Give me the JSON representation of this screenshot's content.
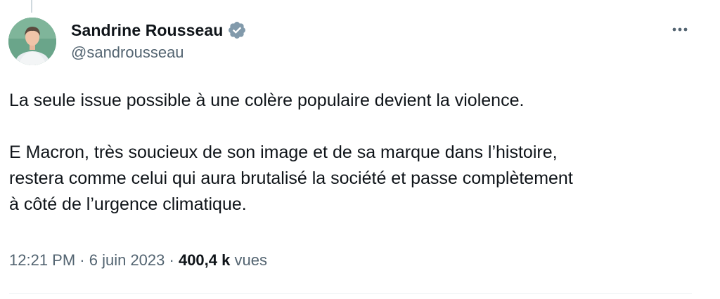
{
  "author": {
    "display_name": "Sandrine Rousseau",
    "handle": "@sandrousseau"
  },
  "tweet": {
    "text": "La seule issue possible à une colère populaire devient la violence.\n\nE Macron, très soucieux de son image et de sa marque dans l’histoire,\nrestera comme celui qui aura brutalisé la société et passe complètement\nà côté de l’urgence climatique."
  },
  "meta": {
    "time": "12:21 PM",
    "separator": " · ",
    "date": "6 juin 2023",
    "views_count": "400,4 k",
    "views_label": "vues"
  },
  "icons": {
    "verified": "verified-badge-icon",
    "more": "more-options-icon"
  },
  "colors": {
    "text_primary": "#0f1419",
    "text_secondary": "#536471",
    "verified_badge": "#829aab",
    "avatar_bg": "#5f9a82"
  }
}
